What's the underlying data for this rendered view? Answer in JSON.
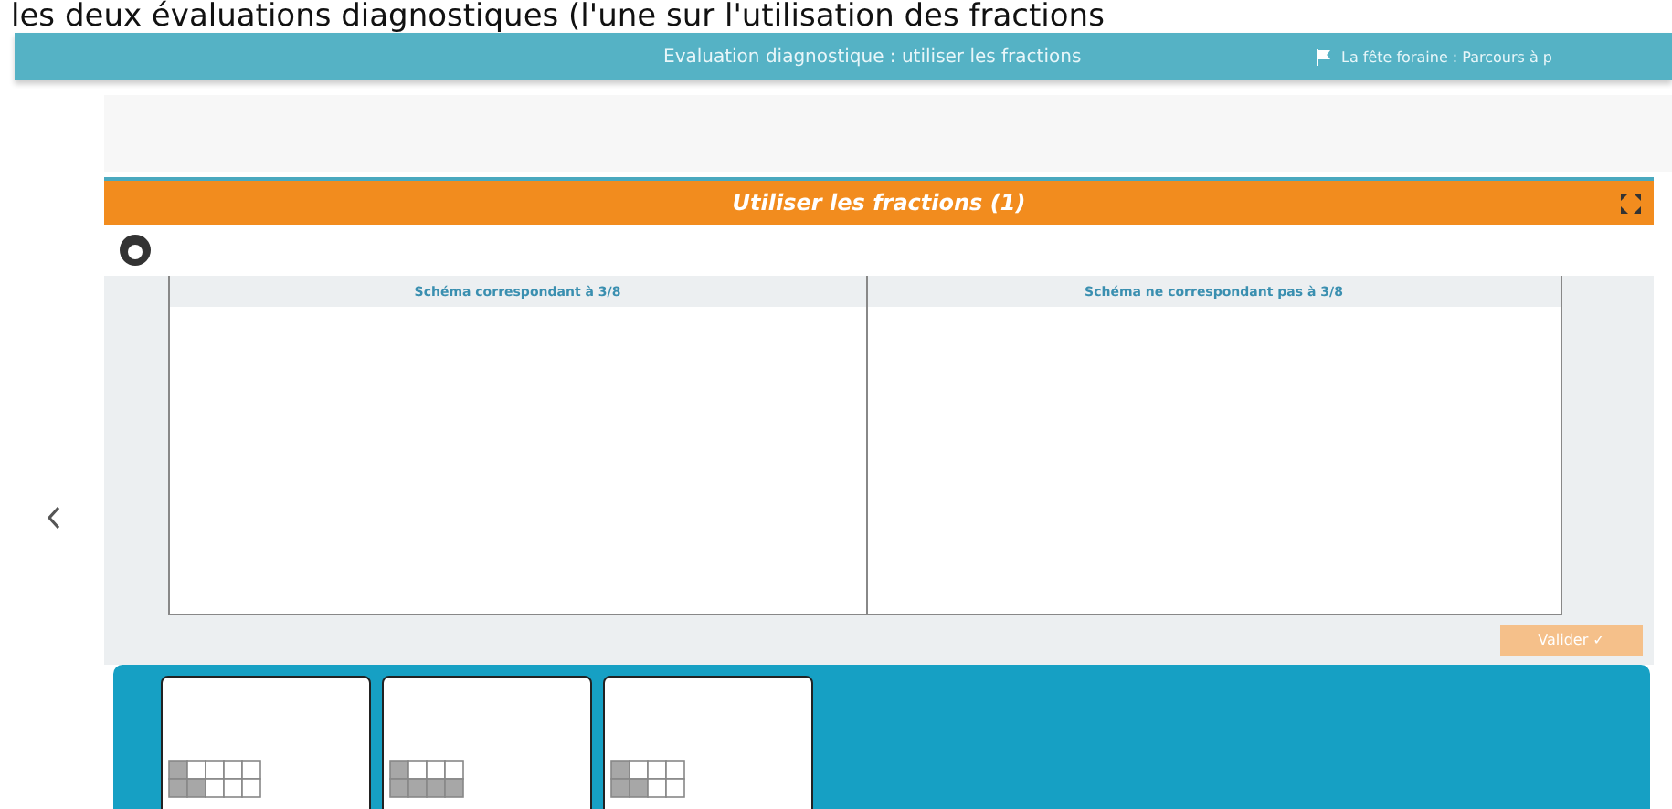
{
  "caption": "les deux évaluations diagnostiques (l'une sur l'utilisation des fractions",
  "header": {
    "title": "Evaluation diagnostique : utiliser les fractions",
    "breadcrumb": "La fête foraine : Parcours à p"
  },
  "activity": {
    "title": "Utiliser les fractions (1)",
    "table": {
      "columns": [
        "Schéma correspondant à 3/8",
        "Schéma ne correspondant pas à 3/8"
      ]
    },
    "validate_button": {
      "label": "Valider ✓",
      "disabled": true
    }
  },
  "cards": [
    {
      "grid": [
        [
          true,
          false,
          false,
          false,
          false
        ],
        [
          true,
          true,
          false,
          false,
          false
        ]
      ]
    },
    {
      "grid": [
        [
          true,
          false,
          false,
          false
        ],
        [
          true,
          true,
          true,
          true
        ]
      ]
    },
    {
      "grid": [
        [
          true,
          false,
          false,
          false
        ],
        [
          true,
          true,
          false,
          false
        ]
      ]
    }
  ]
}
